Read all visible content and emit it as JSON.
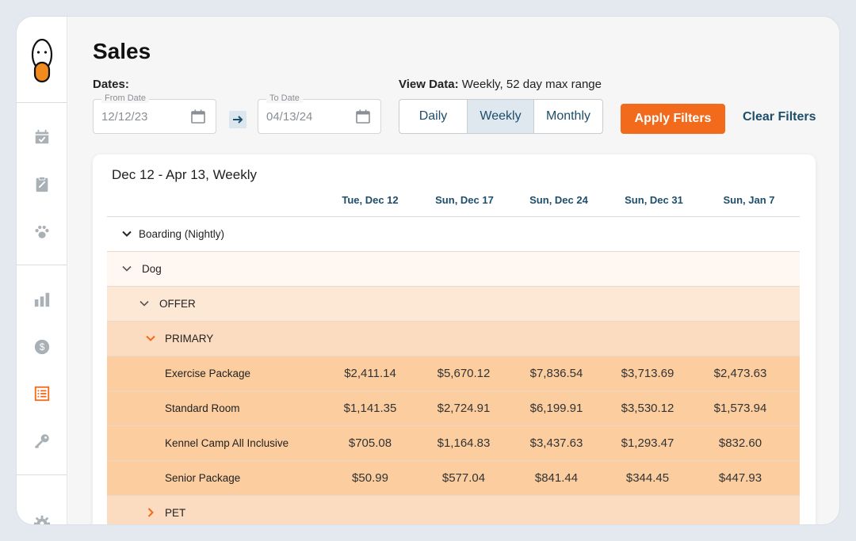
{
  "page": {
    "title": "Sales"
  },
  "filters": {
    "dates_label": "Dates:",
    "from_label": "From Date",
    "from_value": "12/12/23",
    "to_label": "To Date",
    "to_value": "04/13/24",
    "view_label": "View Data:",
    "view_desc": "Weekly, 52 day max range",
    "view_options": [
      "Daily",
      "Weekly",
      "Monthly"
    ],
    "view_selected": "Weekly",
    "apply_label": "Apply Filters",
    "clear_label": "Clear Filters"
  },
  "report": {
    "title": "Dec 12 - Apr 13, Weekly",
    "columns": [
      "Tue, Dec 12",
      "Sun, Dec 17",
      "Sun, Dec 24",
      "Sun, Dec 31",
      "Sun, Jan 7"
    ],
    "rows": [
      {
        "label": "Boarding (Nightly)",
        "level": 0,
        "chevron": "down",
        "values": []
      },
      {
        "label": "Dog",
        "level": 1,
        "chevron": "down",
        "values": []
      },
      {
        "label": "OFFER",
        "level": 2,
        "chevron": "down",
        "values": []
      },
      {
        "label": "PRIMARY",
        "level": 3,
        "chevron": "down-accent",
        "values": []
      },
      {
        "label": "Exercise Package",
        "level": 4,
        "chevron": "",
        "values": [
          "$2,411.14",
          "$5,670.12",
          "$7,836.54",
          "$3,713.69",
          "$2,473.63"
        ]
      },
      {
        "label": "Standard Room",
        "level": 4,
        "chevron": "",
        "values": [
          "$1,141.35",
          "$2,724.91",
          "$6,199.91",
          "$3,530.12",
          "$1,573.94"
        ]
      },
      {
        "label": "Kennel Camp All Inclusive",
        "level": 4,
        "chevron": "",
        "values": [
          "$705.08",
          "$1,164.83",
          "$3,437.63",
          "$1,293.47",
          "$832.60"
        ]
      },
      {
        "label": "Senior Package",
        "level": 4,
        "chevron": "",
        "values": [
          "$50.99",
          "$577.04",
          "$841.44",
          "$344.45",
          "$447.93"
        ]
      },
      {
        "label": "PET",
        "level": 3,
        "chevron": "right-accent",
        "values": []
      }
    ]
  },
  "sidebar": {
    "items": [
      {
        "icon": "calendar-check-icon",
        "active": false
      },
      {
        "icon": "clipboard-icon",
        "active": false
      },
      {
        "icon": "paw-icon",
        "active": false
      },
      {
        "icon": "bar-chart-icon",
        "active": false
      },
      {
        "icon": "dollar-coin-icon",
        "active": false
      },
      {
        "icon": "report-list-icon",
        "active": true
      },
      {
        "icon": "key-icon",
        "active": false
      },
      {
        "icon": "gear-icon",
        "active": false
      }
    ]
  },
  "colors": {
    "accent": "#f26a1b",
    "link": "#1d4e6b",
    "icon": "#a9b0b6"
  }
}
